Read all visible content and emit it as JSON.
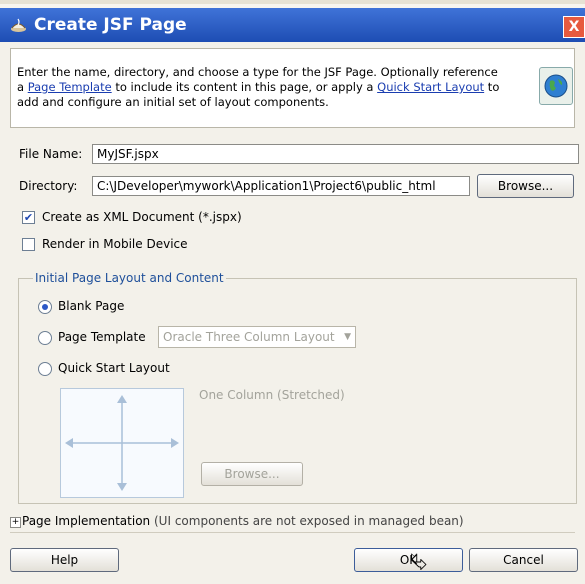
{
  "dialog": {
    "title": "Create JSF Page",
    "close_label": "X",
    "description_before": "Enter the name, directory, and choose a type for the JSF Page. Optionally reference a ",
    "link_page_template": "Page Template",
    "description_middle": " to include its content in this page, or apply a ",
    "link_quick_start": "Quick Start Layout",
    "description_after": " to add and configure an initial set of layout components."
  },
  "form": {
    "file_name_label": "File Name:",
    "file_name_value": "MyJSF.jspx",
    "directory_label": "Directory:",
    "directory_value": "C:\\JDeveloper\\mywork\\Application1\\Project6\\public_html",
    "browse_label": "Browse...",
    "create_xml_label": "Create as XML Document (*.jspx)",
    "render_mobile_label": "Render in Mobile Device"
  },
  "layout_group": {
    "title": "Initial Page Layout and Content",
    "blank_page": "Blank Page",
    "page_template": "Page Template",
    "page_template_select": "Oracle Three Column Layout",
    "quick_start": "Quick Start Layout",
    "quick_start_option": "One Column (Stretched)",
    "browse_label": "Browse..."
  },
  "implementation": {
    "label": "Page Implementation",
    "note": "(UI components are not exposed in managed bean)"
  },
  "buttons": {
    "help": "Help",
    "ok": "OK",
    "cancel": "Cancel"
  }
}
